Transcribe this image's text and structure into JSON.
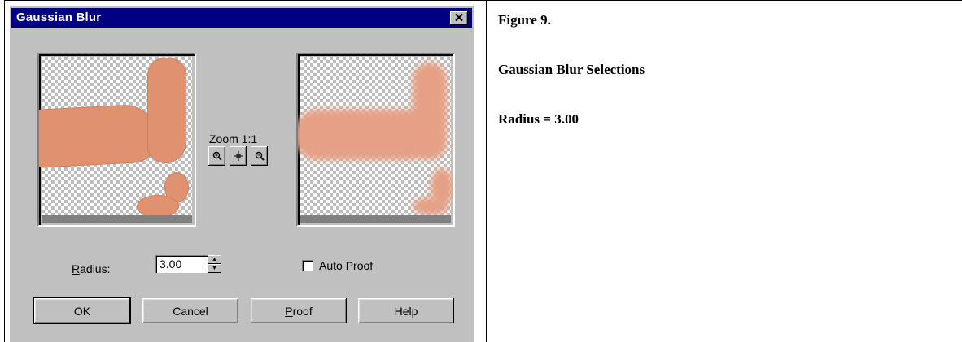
{
  "dialog": {
    "title": "Gaussian Blur",
    "close_glyph": "✕",
    "zoom_label": "Zoom 1:1",
    "zoom_tools": [
      "zoom-in-icon",
      "pan-icon",
      "zoom-out-icon"
    ],
    "radius_label": "Radius:",
    "radius_value": "3.00",
    "auto_proof_label": "Auto Proof",
    "auto_proof_checked": false,
    "buttons": {
      "ok": "OK",
      "cancel": "Cancel",
      "proof": "Proof",
      "help": "Help"
    }
  },
  "document": {
    "figure_label": "Figure 9.",
    "caption": "Gaussian Blur Selections",
    "radius_note": "Radius = 3.00"
  },
  "colors": {
    "titlebar": "#000080",
    "dialog_face": "#c0c0c0",
    "skin": "#e29578"
  }
}
